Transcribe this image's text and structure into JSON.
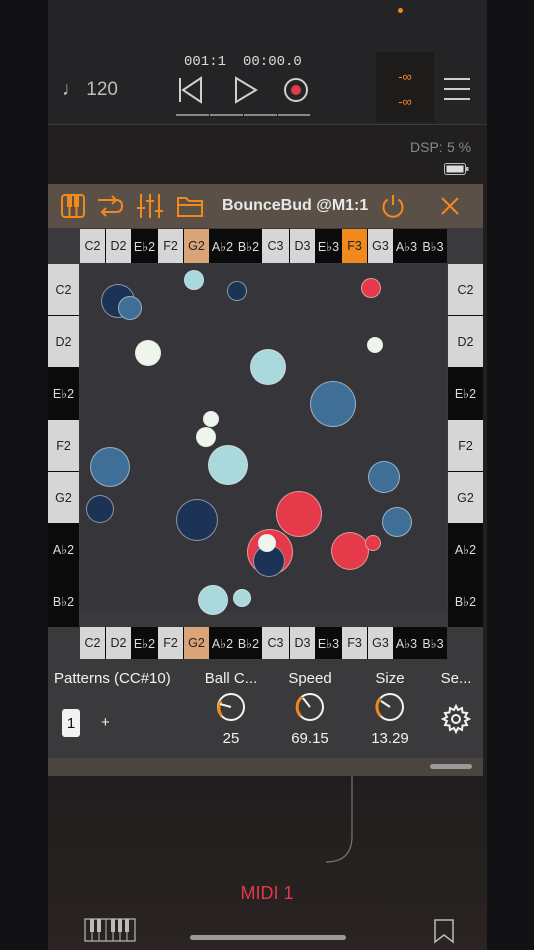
{
  "transport": {
    "tempo": "♩ 120",
    "position": "001:1",
    "time": "00:00.0",
    "level_top": "-∞",
    "level_bottom": "-∞"
  },
  "dsp": {
    "label": "DSP:",
    "value": "5 %"
  },
  "plugin": {
    "title": "BounceBud @M1:1",
    "top_keys": [
      {
        "label": "C2",
        "kind": "w"
      },
      {
        "label": "D2",
        "kind": "w"
      },
      {
        "label": "E♭2",
        "kind": "b"
      },
      {
        "label": "F2",
        "kind": "w"
      },
      {
        "label": "G2",
        "kind": "t"
      },
      {
        "label": "A♭2",
        "kind": "b"
      },
      {
        "label": "B♭2",
        "kind": "b"
      },
      {
        "label": "C3",
        "kind": "w"
      },
      {
        "label": "D3",
        "kind": "w"
      },
      {
        "label": "E♭3",
        "kind": "b"
      },
      {
        "label": "F3",
        "kind": "o"
      },
      {
        "label": "G3",
        "kind": "w"
      },
      {
        "label": "A♭3",
        "kind": "b"
      },
      {
        "label": "B♭3",
        "kind": "b"
      }
    ],
    "bottom_keys": [
      {
        "label": "C2",
        "kind": "w"
      },
      {
        "label": "D2",
        "kind": "w"
      },
      {
        "label": "E♭2",
        "kind": "b"
      },
      {
        "label": "F2",
        "kind": "w"
      },
      {
        "label": "G2",
        "kind": "t"
      },
      {
        "label": "A♭2",
        "kind": "b"
      },
      {
        "label": "B♭2",
        "kind": "b"
      },
      {
        "label": "C3",
        "kind": "w"
      },
      {
        "label": "D3",
        "kind": "w"
      },
      {
        "label": "E♭3",
        "kind": "b"
      },
      {
        "label": "F3",
        "kind": "w"
      },
      {
        "label": "G3",
        "kind": "w"
      },
      {
        "label": "A♭3",
        "kind": "b"
      },
      {
        "label": "B♭3",
        "kind": "b"
      }
    ],
    "side_keys": [
      {
        "label": "C2",
        "kind": "w"
      },
      {
        "label": "D2",
        "kind": "w"
      },
      {
        "label": "E♭2",
        "kind": "b"
      },
      {
        "label": "F2",
        "kind": "w"
      },
      {
        "label": "G2",
        "kind": "w"
      },
      {
        "label": "A♭2",
        "kind": "b"
      },
      {
        "label": "B♭2",
        "kind": "b"
      }
    ],
    "balls": [
      {
        "color": "dark"
      },
      {
        "color": "blue"
      },
      {
        "color": "light"
      },
      {
        "color": "dark"
      },
      {
        "color": "red"
      },
      {
        "color": "white"
      },
      {
        "color": "white"
      },
      {
        "color": "light"
      },
      {
        "color": "blue"
      },
      {
        "color": "white"
      },
      {
        "color": "white"
      },
      {
        "color": "light"
      },
      {
        "color": "blue"
      },
      {
        "color": "blue"
      },
      {
        "color": "dark"
      },
      {
        "color": "dark"
      },
      {
        "color": "red"
      },
      {
        "color": "blue"
      },
      {
        "color": "red"
      },
      {
        "color": "red"
      },
      {
        "color": "red"
      },
      {
        "color": "dark"
      },
      {
        "color": "white"
      },
      {
        "color": "light"
      },
      {
        "color": "light"
      }
    ],
    "patterns_label": "Patterns (CC#10)",
    "pattern_active": "1",
    "pattern_add": "+",
    "knobs": [
      {
        "label": "Ball C...",
        "value": "25"
      },
      {
        "label": "Speed",
        "value": "69.15"
      },
      {
        "label": "Size",
        "value": "13.29"
      }
    ],
    "settings_label": "Se..."
  },
  "track_name": "MIDI 1",
  "colors": {
    "accent": "#f08a1c",
    "ball_dark": "#1d3356",
    "ball_blue": "#3f6f97",
    "ball_light": "#a9d8dd",
    "ball_white": "#eef5ec",
    "ball_red": "#e43a4a",
    "record": "#e23b4a",
    "track_name": "#e0394c"
  }
}
